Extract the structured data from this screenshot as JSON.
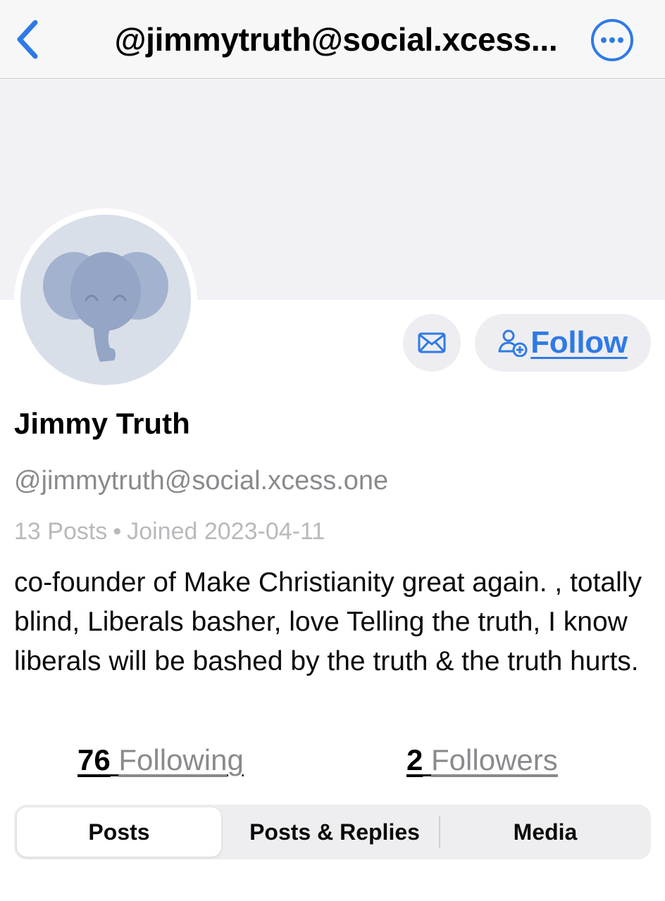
{
  "nav": {
    "title": "@jimmytruth@social.xcess...",
    "back_icon": "chevron-left-icon",
    "more_icon": "ellipsis-circle-icon"
  },
  "profile": {
    "display_name": "Jimmy Truth",
    "handle": "@jimmytruth@social.xcess.one",
    "posts_count": "13 Posts",
    "separator": "•",
    "joined": "Joined 2023-04-11",
    "bio": "co-founder of Make Christianity great again. , totally blind, Liberals basher, love Telling the truth, I know liberals will be bashed by the truth & the truth hurts.",
    "avatar_icon": "elephant-icon"
  },
  "actions": {
    "message_icon": "envelope-icon",
    "follow_icon": "person-add-icon",
    "follow_label": "Follow"
  },
  "stats": {
    "following_count": "76",
    "following_label": "Following",
    "followers_count": "2",
    "followers_label": "Followers"
  },
  "tabs": [
    {
      "label": "Posts",
      "selected": true
    },
    {
      "label": "Posts & Replies",
      "selected": false
    },
    {
      "label": "Media",
      "selected": false
    }
  ],
  "colors": {
    "accent": "#2f7ae5",
    "banner": "#f1f1f6",
    "avatar_bg": "#d9dfe8",
    "elephant": "#a3b2cf"
  }
}
